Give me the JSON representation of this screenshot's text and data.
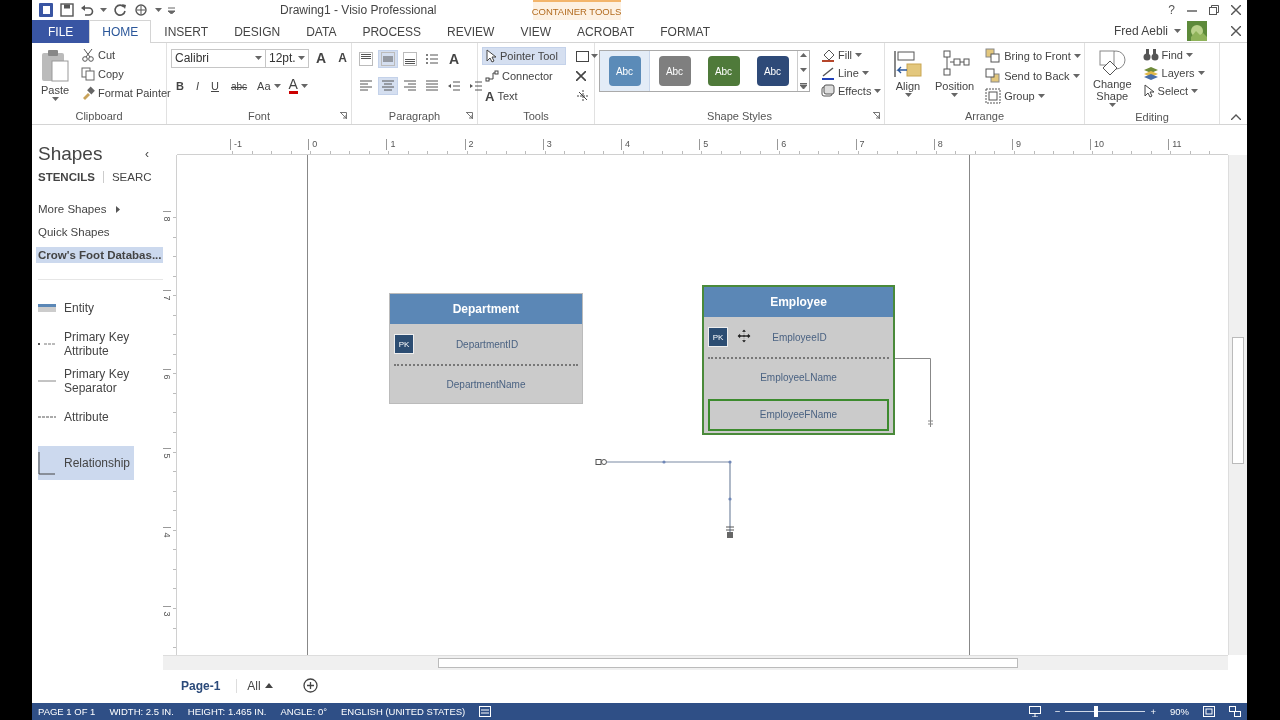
{
  "window": {
    "title": "Drawing1 - Visio Professional",
    "contextual_tab_group": "CONTAINER TOOLS",
    "help": "?"
  },
  "tabs": [
    {
      "label": "FILE",
      "kind": "file",
      "selected": false
    },
    {
      "label": "HOME",
      "kind": "tab",
      "selected": true
    },
    {
      "label": "INSERT",
      "kind": "tab",
      "selected": false
    },
    {
      "label": "DESIGN",
      "kind": "tab",
      "selected": false
    },
    {
      "label": "DATA",
      "kind": "tab",
      "selected": false
    },
    {
      "label": "PROCESS",
      "kind": "tab",
      "selected": false
    },
    {
      "label": "REVIEW",
      "kind": "tab",
      "selected": false
    },
    {
      "label": "VIEW",
      "kind": "tab",
      "selected": false
    },
    {
      "label": "ACROBAT",
      "kind": "tab",
      "selected": false
    },
    {
      "label": "FORMAT",
      "kind": "tab",
      "selected": false
    }
  ],
  "account": {
    "user": "Fred Aebli"
  },
  "clipboard": {
    "title": "Clipboard",
    "paste": "Paste",
    "commands": [
      "Cut",
      "Copy",
      "Format Painter"
    ]
  },
  "font": {
    "title": "Font",
    "font_name": "Calibri",
    "font_size": "12pt.",
    "grow": "A",
    "shrink": "A",
    "styles": [
      "B",
      "I",
      "U",
      "abc"
    ],
    "change_case": "Aa",
    "font_color": "A"
  },
  "paragraph": {
    "title": "Paragraph",
    "text_block": "A",
    "vertical_align": [
      {
        "selected": false
      },
      {
        "selected": true
      },
      {
        "selected": false
      }
    ],
    "horizontal_align": [
      {
        "selected": false
      },
      {
        "selected": true
      },
      {
        "selected": false
      },
      {
        "selected": false
      }
    ]
  },
  "tools": {
    "title": "Tools",
    "items": [
      {
        "label": "Pointer Tool",
        "kind": "pointer",
        "selected": true
      },
      {
        "label": "Connector",
        "kind": "connector",
        "selected": false
      },
      {
        "label": "Text",
        "kind": "text",
        "glyph": "A",
        "selected": false
      }
    ]
  },
  "shape_styles": {
    "title": "Shape Styles",
    "swatches": [
      {
        "label": "Abc",
        "color": "#5b8bb8",
        "selected": true
      },
      {
        "label": "Abc",
        "color": "#7f7f7f",
        "selected": false
      },
      {
        "label": "Abc",
        "color": "#4f7a3a",
        "selected": false
      },
      {
        "label": "Abc",
        "color": "#2e4a78",
        "selected": false
      }
    ],
    "commands": [
      {
        "label": "Fill",
        "kind": "fill"
      },
      {
        "label": "Line",
        "kind": "line"
      },
      {
        "label": "Effects",
        "kind": "effects"
      }
    ]
  },
  "arrange": {
    "title": "Arrange",
    "large": [
      {
        "label": "Align",
        "kind": "align"
      },
      {
        "label": "Position",
        "kind": "position"
      }
    ],
    "commands": [
      {
        "label": "Bring to Front",
        "kind": "front"
      },
      {
        "label": "Send to Back",
        "kind": "back"
      },
      {
        "label": "Group",
        "kind": "group"
      }
    ]
  },
  "editing": {
    "title": "Editing",
    "change_shape": "Change Shape",
    "commands": [
      {
        "label": "Find",
        "kind": "find"
      },
      {
        "label": "Layers",
        "kind": "layers"
      },
      {
        "label": "Select",
        "kind": "select"
      }
    ]
  },
  "shapes_panel": {
    "title": "Shapes",
    "collapse": "‹",
    "tabs": [
      {
        "label": "STENCILS",
        "selected": true
      },
      {
        "label": "SEARC",
        "selected": false
      }
    ],
    "stencil_links": [
      {
        "label": "More Shapes",
        "kind": "menu",
        "selected": false
      },
      {
        "label": "Quick Shapes",
        "kind": "link",
        "selected": false
      },
      {
        "label": "Crow's Foot Databas...",
        "kind": "link",
        "selected": true
      }
    ],
    "masters": [
      {
        "label": "Entity",
        "kind": "entity",
        "selected": false
      },
      {
        "label": "Primary Key Attribute",
        "kind": "key",
        "selected": false
      },
      {
        "label": "Primary Key Separator",
        "kind": "separator",
        "selected": false
      },
      {
        "label": "Attribute",
        "kind": "attribute",
        "selected": false
      },
      {
        "label": "Relationship",
        "kind": "relationship",
        "selected": true
      }
    ]
  },
  "rulers": {
    "horizontal": [
      "-1",
      "0",
      "1",
      "2",
      "3",
      "4",
      "5",
      "6",
      "7",
      "8",
      "9",
      "10",
      "11"
    ],
    "vertical": [
      "8",
      "7",
      "6",
      "5",
      "4",
      "3"
    ]
  },
  "entities": [
    {
      "name": "Department",
      "selected": false,
      "fields": [
        {
          "kind": "key",
          "key": "PK",
          "name": "DepartmentID",
          "selected": false
        },
        {
          "kind": "separator"
        },
        {
          "kind": "attribute",
          "name": "DepartmentName",
          "selected": false
        }
      ]
    },
    {
      "name": "Employee",
      "selected": true,
      "fields": [
        {
          "kind": "key",
          "key": "PK",
          "name": "EmployeeID",
          "selected": false
        },
        {
          "kind": "separator"
        },
        {
          "kind": "attribute",
          "name": "EmployeeLName",
          "selected": false
        },
        {
          "kind": "attribute",
          "name": "EmployeeFName",
          "selected": true
        }
      ]
    }
  ],
  "pages": {
    "tabs": [
      {
        "label": "Page-1",
        "selected": true
      }
    ],
    "all": "All"
  },
  "status_bar": {
    "items": [
      "PAGE 1 OF 1",
      "WIDTH: 2.5 IN.",
      "HEIGHT: 1.465 IN.",
      "ANGLE: 0°",
      "ENGLISH (UNITED STATES)"
    ],
    "zoom_out": "−",
    "zoom_in": "+",
    "zoom": {
      "level": 0.38
    },
    "zoom_reading": "90%"
  }
}
